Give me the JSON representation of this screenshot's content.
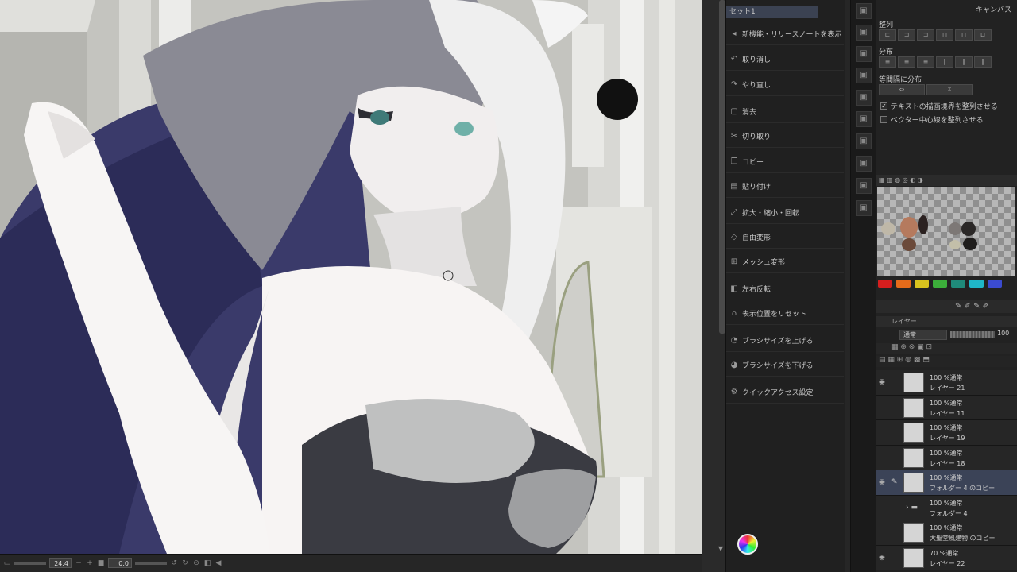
{
  "canvas": {
    "zoom": "24.4",
    "rotation": "0.0"
  },
  "command_panel": {
    "tab_label": "セット1",
    "items": [
      {
        "label": "新機能・リリースノートを表示",
        "icon": "megaphone-icon"
      },
      {
        "label": "取り消し",
        "icon": "undo-icon"
      },
      {
        "label": "やり直し",
        "icon": "redo-icon"
      },
      {
        "label": "消去",
        "icon": "eraser-icon"
      },
      {
        "label": "切り取り",
        "icon": "scissors-icon"
      },
      {
        "label": "コピー",
        "icon": "copy-icon"
      },
      {
        "label": "貼り付け",
        "icon": "paste-icon"
      },
      {
        "label": "拡大・縮小・回転",
        "icon": "scale-icon"
      },
      {
        "label": "自由変形",
        "icon": "free-transform-icon"
      },
      {
        "label": "メッシュ変形",
        "icon": "mesh-icon"
      },
      {
        "label": "左右反転",
        "icon": "flip-icon"
      },
      {
        "label": "表示位置をリセット",
        "icon": "reset-view-icon"
      },
      {
        "label": "ブラシサイズを上げる",
        "icon": "brush-up-icon"
      },
      {
        "label": "ブラシサイズを下げる",
        "icon": "brush-down-icon"
      },
      {
        "label": "クイックアクセス設定",
        "icon": "settings-icon"
      }
    ]
  },
  "align_panel": {
    "header": "キャンバス",
    "align_label": "整列",
    "distribute_label": "分布",
    "equal_label": "等間隔に分布",
    "check_text_bounds": "テキストの描画境界を整列させる",
    "check_vector_center": "ベクター中心線を整列させる"
  },
  "palette": {
    "colors": [
      "#d61e1e",
      "#e56b1a",
      "#d8c21e",
      "#3cae3a",
      "#1f8a7a",
      "#1fb6c8",
      "#3b4bd0",
      "#9a2fc0"
    ]
  },
  "layers_panel": {
    "tab_label": "レイヤー",
    "blend_mode": "通常",
    "opacity": "100",
    "layers": [
      {
        "line1": "100 %通常",
        "line2": "レイヤー 21",
        "selected": false
      },
      {
        "line1": "100 %通常",
        "line2": "レイヤー 11",
        "selected": false
      },
      {
        "line1": "100 %通常",
        "line2": "レイヤー 19",
        "selected": false
      },
      {
        "line1": "100 %通常",
        "line2": "レイヤー 18",
        "selected": false
      },
      {
        "line1": "100 %通常",
        "line2": "フォルダー 4 のコピー",
        "selected": true
      },
      {
        "line1": "100 %通常",
        "line2": "フォルダー 4",
        "selected": false
      },
      {
        "line1": "100 %通常",
        "line2": "大聖堂風建物 のコピー",
        "selected": false
      },
      {
        "line1": "70 %通常",
        "line2": "レイヤー 22",
        "selected": false
      }
    ]
  }
}
